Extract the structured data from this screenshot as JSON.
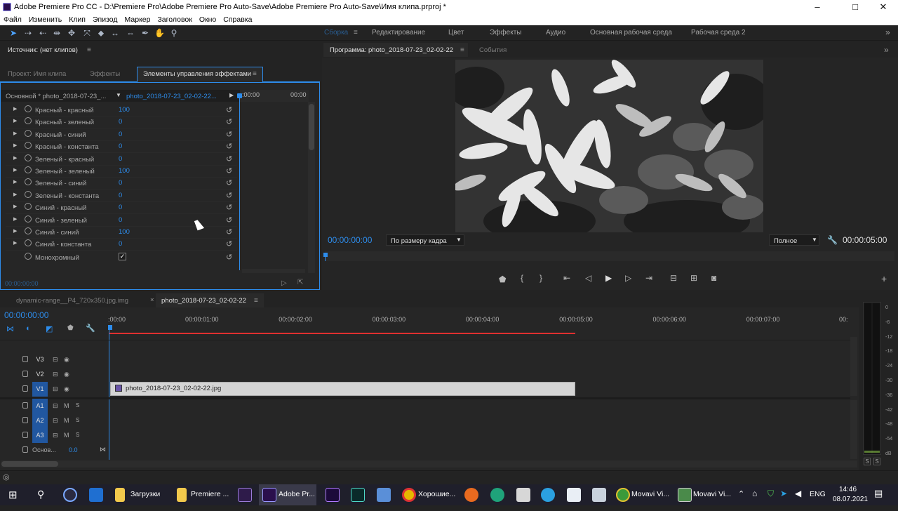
{
  "window": {
    "title": "Adobe Premiere Pro CC - D:\\Premiere Pro\\Adobe Premiere Pro Auto-Save\\Adobe Premiere Pro Auto-Save\\Имя клипа.prproj *",
    "minimize": "–",
    "maximize": "□",
    "close": "✕"
  },
  "menu": [
    "Файл",
    "Изменить",
    "Клип",
    "Эпизод",
    "Маркер",
    "Заголовок",
    "Окно",
    "Справка"
  ],
  "workspaces": [
    "Сборка",
    "Редактирование",
    "Цвет",
    "Эффекты",
    "Аудио",
    "Основная рабочая среда",
    "Рабочая среда 2"
  ],
  "source_panel": {
    "title": "Источник: (нет клипов)"
  },
  "effect_panel": {
    "tabs": [
      "Проект: Имя клипа",
      "Эффекты",
      "Элементы управления эффектами"
    ],
    "master": "Основной * photo_2018-07-23_...",
    "clip": "photo_2018-07-23_02-02-22...",
    "mini_time_start": ":00:00",
    "mini_time_end": "00:00",
    "rows": [
      {
        "name": "Красный - красный",
        "value": "100"
      },
      {
        "name": "Красный - зеленый",
        "value": "0"
      },
      {
        "name": "Красный - синий",
        "value": "0"
      },
      {
        "name": "Красный - константа",
        "value": "0"
      },
      {
        "name": "Зеленый - красный",
        "value": "0"
      },
      {
        "name": "Зеленый - зеленый",
        "value": "100"
      },
      {
        "name": "Зеленый - синий",
        "value": "0"
      },
      {
        "name": "Зеленый - константа",
        "value": "0"
      },
      {
        "name": "Синий - красный",
        "value": "0"
      },
      {
        "name": "Синий - зеленый",
        "value": "0"
      },
      {
        "name": "Синий - синий",
        "value": "100"
      },
      {
        "name": "Синий - константа",
        "value": "0"
      }
    ],
    "monochrome_label": "Монохромный",
    "monochrome_checked": true,
    "timecode": "00:00:00:00"
  },
  "program_panel": {
    "title": "Программа: photo_2018-07-23_02-02-22",
    "events_tab": "События",
    "timecode_current": "00:00:00:00",
    "fit": "По размеру кадра",
    "quality": "Полное",
    "timecode_duration": "00:00:05:00"
  },
  "timeline": {
    "tabs": [
      "dynamic-range__P4_720x350.jpg.img",
      "photo_2018-07-23_02-02-22"
    ],
    "close_glyph": "×",
    "timecode": "00:00:00:00",
    "ruler": [
      ":00:00",
      "00:00:01:00",
      "00:00:02:00",
      "00:00:03:00",
      "00:00:04:00",
      "00:00:05:00",
      "00:00:06:00",
      "00:00:07:00",
      "00:"
    ],
    "video_tracks": [
      "V3",
      "V2",
      "V1"
    ],
    "audio_tracks": [
      "A1",
      "A2",
      "A3"
    ],
    "mute": "M",
    "solo": "S",
    "master_track": "Основ...",
    "master_value": "0.0",
    "clip_name": "photo_2018-07-23_02-02-22.jpg"
  },
  "audio_meter": {
    "scale": [
      "0",
      "-6",
      "-12",
      "-18",
      "-24",
      "-30",
      "-36",
      "-42",
      "-48",
      "-54",
      "dB"
    ],
    "buttons": [
      "S",
      "S"
    ]
  },
  "taskbar": {
    "items": [
      "Загрузки",
      "Premiere ...",
      "Adobe Pr...",
      "Хорошие...",
      "Movavi Vi...",
      "Movavi Vi..."
    ],
    "lang": "ENG",
    "time": "14:46",
    "date": "08.07.2021"
  },
  "colors": {
    "accent": "#2d8ceb",
    "playhead": "#e03030",
    "panel_bg": "#232323"
  }
}
